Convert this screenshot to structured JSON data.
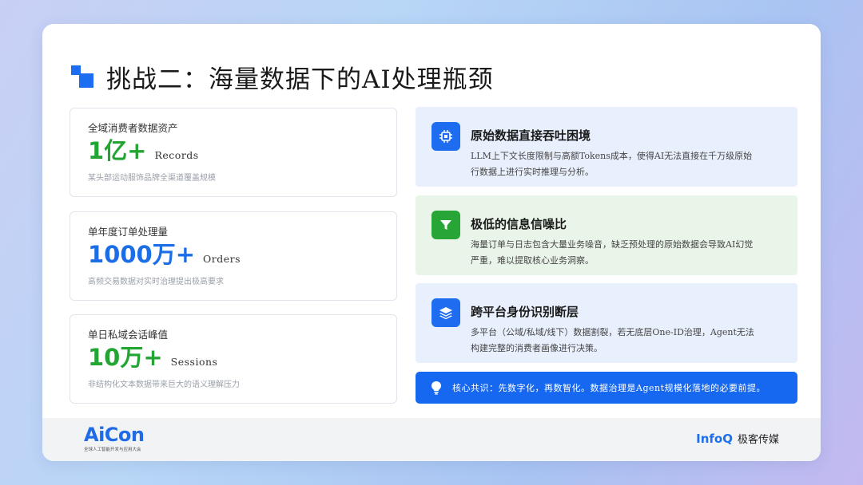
{
  "title": "挑战二：海量数据下的AI处理瓶颈",
  "stats": [
    {
      "label": "全域消费者数据资产",
      "value": "1亿+",
      "unit": "Records",
      "desc": "某头部运动服饰品牌全渠道覆盖规模",
      "color": "#23a534"
    },
    {
      "label": "单年度订单处理量",
      "value": "1000万+",
      "unit": "Orders",
      "desc": "高频交易数据对实时治理提出极高要求",
      "color": "#1b6ee6"
    },
    {
      "label": "单日私域会话峰值",
      "value": "10万+",
      "unit": "Sessions",
      "desc": "非结构化文本数据带来巨大的语义理解压力",
      "color": "#23a534"
    }
  ],
  "challenges": [
    {
      "title": "原始数据直接吞吐困境",
      "desc": "LLM上下文长度限制与高额Tokens成本，使得AI无法直接在千万级原始行数据上进行实时推理与分析。",
      "icon": "cpu-chip-icon"
    },
    {
      "title": "极低的信息信噪比",
      "desc": "海量订单与日志包含大量业务噪音，缺乏预处理的原始数据会导致AI幻觉严重，难以提取核心业务洞察。",
      "icon": "filter-icon"
    },
    {
      "title": "跨平台身份识别断层",
      "desc": "多平台（公域/私域/线下）数据割裂，若无底层One-ID治理，Agent无法构建完整的消费者画像进行决策。",
      "icon": "layers-icon"
    }
  ],
  "consensus": {
    "text": "核心共识：先数字化，再数智化。数据治理是Agent规模化落地的必要前提。",
    "icon": "lightbulb-icon"
  },
  "footer": {
    "aicon_logo": "AiCon",
    "aicon_sub": "全球人工智能开发与应用大会",
    "infoq_logo": "InfoQ",
    "infoq_cn": "极客传媒"
  },
  "colors": {
    "accent_blue": "#1768f0",
    "accent_green": "#23a534"
  }
}
